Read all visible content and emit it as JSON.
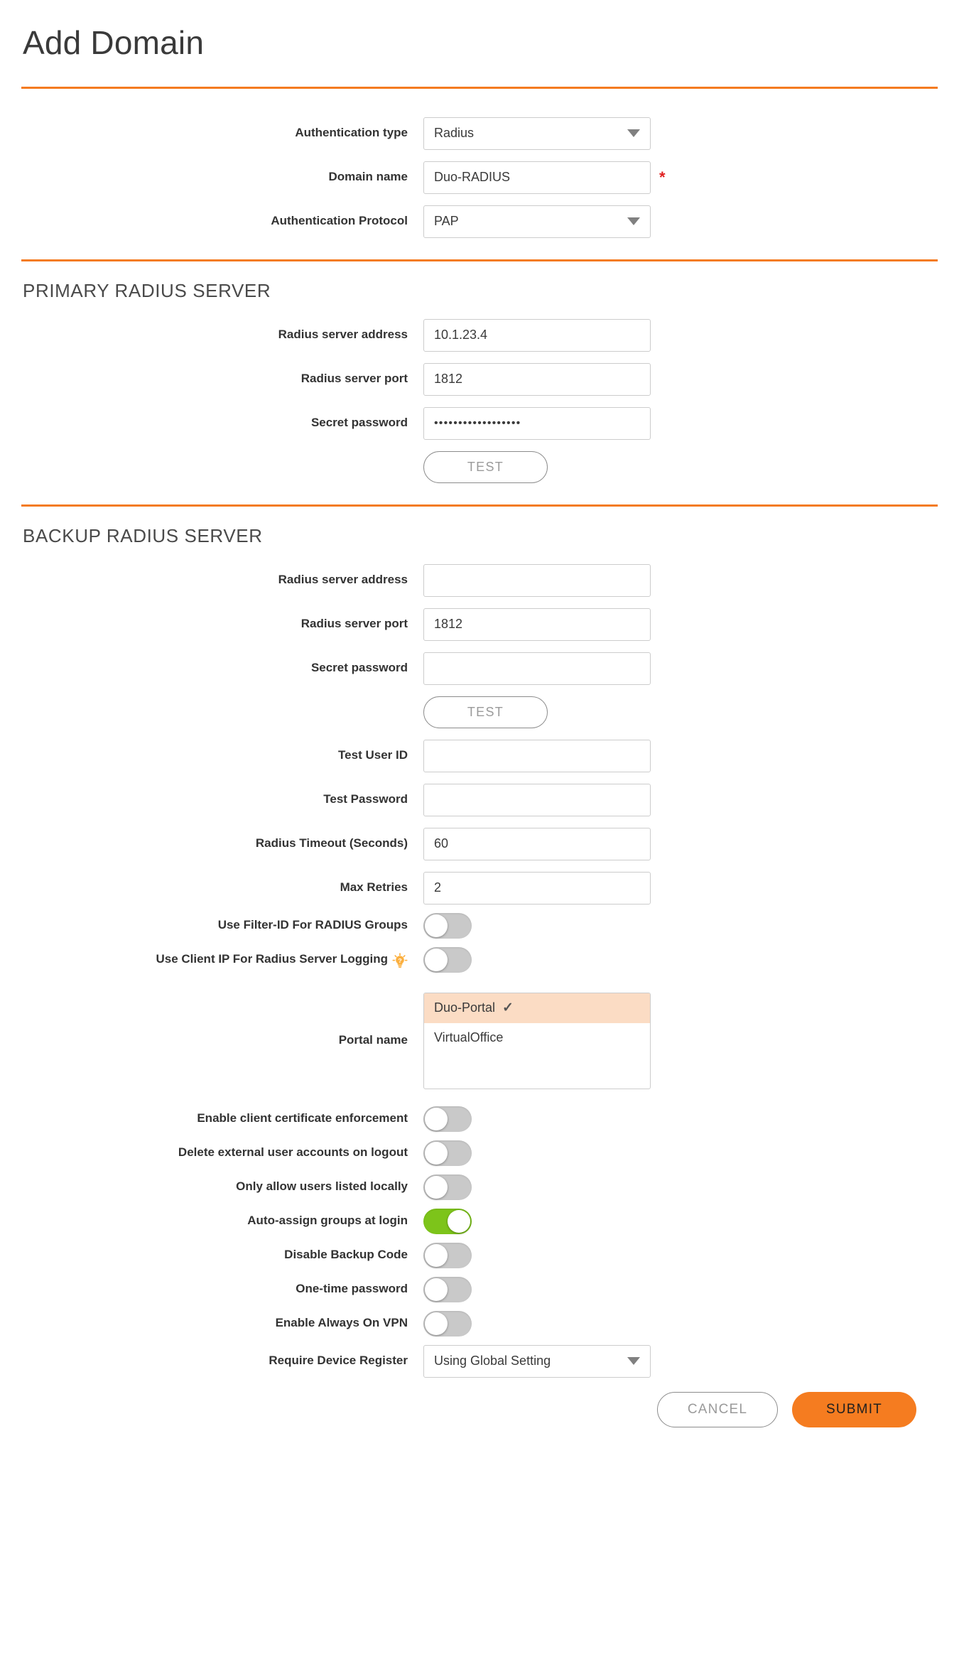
{
  "page": {
    "title": "Add Domain",
    "accent_color": "#F47B20",
    "toggle_on_color": "#7DC41A",
    "selected_row_color": "#FBDCC4",
    "required_marker": "*"
  },
  "general": {
    "fields": [
      {
        "label": "Authentication type",
        "type": "select",
        "value": "Radius",
        "required": false
      },
      {
        "label": "Domain name",
        "type": "text",
        "value": "Duo-RADIUS",
        "required": true
      },
      {
        "label": "Authentication Protocol",
        "type": "select",
        "value": "PAP",
        "required": false
      }
    ]
  },
  "primary_server": {
    "heading": "PRIMARY RADIUS SERVER",
    "fields": [
      {
        "label": "Radius server address",
        "type": "text",
        "value": "10.1.23.4"
      },
      {
        "label": "Radius server port",
        "type": "text",
        "value": "1812"
      },
      {
        "label": "Secret password",
        "type": "password",
        "value": "••••••••••••••••••"
      }
    ],
    "test_button": "TEST"
  },
  "backup_server": {
    "heading": "BACKUP RADIUS SERVER",
    "fields": [
      {
        "label": "Radius server address",
        "type": "text",
        "value": ""
      },
      {
        "label": "Radius server port",
        "type": "text",
        "value": "1812"
      },
      {
        "label": "Secret password",
        "type": "password",
        "value": ""
      }
    ],
    "test_button": "TEST",
    "extra_fields": [
      {
        "label": "Test User ID",
        "type": "text",
        "value": ""
      },
      {
        "label": "Test Password",
        "type": "password",
        "value": ""
      },
      {
        "label": "Radius Timeout (Seconds)",
        "type": "text",
        "value": "60"
      },
      {
        "label": "Max Retries",
        "type": "text",
        "value": "2"
      }
    ],
    "toggles": [
      {
        "label": "Use Filter-ID For RADIUS Groups",
        "on": false,
        "help": false
      },
      {
        "label": "Use Client IP For Radius Server Logging",
        "on": false,
        "help": true
      }
    ]
  },
  "portal": {
    "label": "Portal name",
    "options": [
      {
        "name": "Duo-Portal",
        "selected": true
      },
      {
        "name": "VirtualOffice",
        "selected": false
      }
    ],
    "check_glyph": "✓"
  },
  "options": {
    "toggles": [
      {
        "label": "Enable client certificate enforcement",
        "on": false
      },
      {
        "label": "Delete external user accounts on logout",
        "on": false
      },
      {
        "label": "Only allow users listed locally",
        "on": false
      },
      {
        "label": "Auto-assign groups at login",
        "on": true
      },
      {
        "label": "Disable Backup Code",
        "on": false
      },
      {
        "label": "One-time password",
        "on": false
      },
      {
        "label": "Enable Always On VPN",
        "on": false
      }
    ],
    "device_register": {
      "label": "Require Device Register",
      "value": "Using Global Setting"
    }
  },
  "footer": {
    "cancel_label": "CANCEL",
    "submit_label": "SUBMIT"
  }
}
